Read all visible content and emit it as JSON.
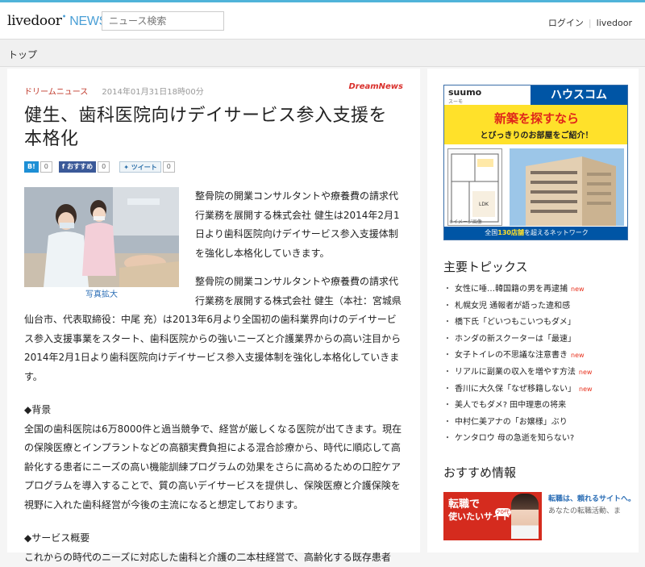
{
  "header": {
    "logo_main": "livedoor",
    "logo_news": "NEWS",
    "search_placeholder": "ニュース検索",
    "login": "ログイン",
    "livedoor": "livedoor"
  },
  "breadcrumb": {
    "top": "トップ"
  },
  "article": {
    "source": "ドリームニュース",
    "date": "2014年01月31日18時00分",
    "source_logo": "DreamNews",
    "title": "健生、歯科医院向けデイサービス参入支援を本格化",
    "social": {
      "hatena_label": "B!",
      "hatena_count": "0",
      "fb_label": "おすすめ",
      "fb_count": "0",
      "tw_label": "ツイート",
      "tw_count": "0"
    },
    "photo_caption": "写真拡大",
    "paragraphs": [
      "整骨院の開業コンサルタントや療養費の請求代行業務を展開する株式会社 健生は2014年2月1日より歯科医院向けデイサービス参入支援体制を強化し本格化していきます。",
      "整骨院の開業コンサルタントや療養費の請求代行業務を展開する株式会社 健生（本社：宮城県仙台市、代表取締役：中尾 充）は2013年6月より全国初の歯科業界向けのデイサービス参入支援事業をスタート、歯科医院からの強いニーズと介護業界からの高い注目から2014年2月1日より歯科医院向けデイサービス参入支援体制を強化し本格化していきます。",
      "◆背景",
      "全国の歯科医院は6万8000件と過当競争で、経営が厳しくなる医院が出てきます。現在の保険医療とインプラントなどの高額実費負担による混合診療から、時代に順応して高齢化する患者にニーズの高い機能訓練プログラムの効果をさらに高めるための口腔ケアプログラムを導入することで、質の高いデイサービスを提供し、保険医療と介護保険を視野に入れた歯科経営が今後の主流になると想定しております。",
      "◆サービス概要",
      "これからの時代のニーズに対応した歯科と介護の二本柱経営で、高齢化する既存患者"
    ]
  },
  "ad_suumo": {
    "suumo": "suumo",
    "suumo_sub": "スーモ",
    "housecom": "ハウスコム",
    "headline": "新築を探すなら",
    "subline": "とびっきりのお部屋をご紹介！",
    "note": "※イメージ画像",
    "footer_pre": "全国",
    "footer_num": "130店舗",
    "footer_post": "を超えるネットワーク",
    "floor_label": "LDK"
  },
  "sidebar": {
    "topics_title": "主要トピックス",
    "new_label": "new",
    "topics": [
      {
        "text": "女性に唾…韓国籍の男を再逮捕",
        "new": true
      },
      {
        "text": "札幌女児 通報者が語った違和感",
        "new": false
      },
      {
        "text": "橋下氏「どいつもこいつもダメ」",
        "new": false
      },
      {
        "text": "ホンダの新スクーターは「最速」",
        "new": false
      },
      {
        "text": "女子トイレの不思議な注意書き",
        "new": true
      },
      {
        "text": "リアルに副業の収入を増やす方法",
        "new": true
      },
      {
        "text": "香川に大久保「なぜ移籍しない」",
        "new": true
      },
      {
        "text": "美人でもダメ? 田中理恵の将来",
        "new": false
      },
      {
        "text": "中村仁美アナの「お嬢様」ぶり",
        "new": false
      },
      {
        "text": "ケンタロウ 母の急逝を知らない?",
        "new": false
      }
    ],
    "rec_title": "おすすめ情報",
    "rec_ad": {
      "img_t1": "転職で",
      "img_t2": "使いたいサイト",
      "badge": "20代",
      "link": "転職は、頼れるサイトへ。",
      "desc": "あなたの転職活動、ま"
    }
  }
}
